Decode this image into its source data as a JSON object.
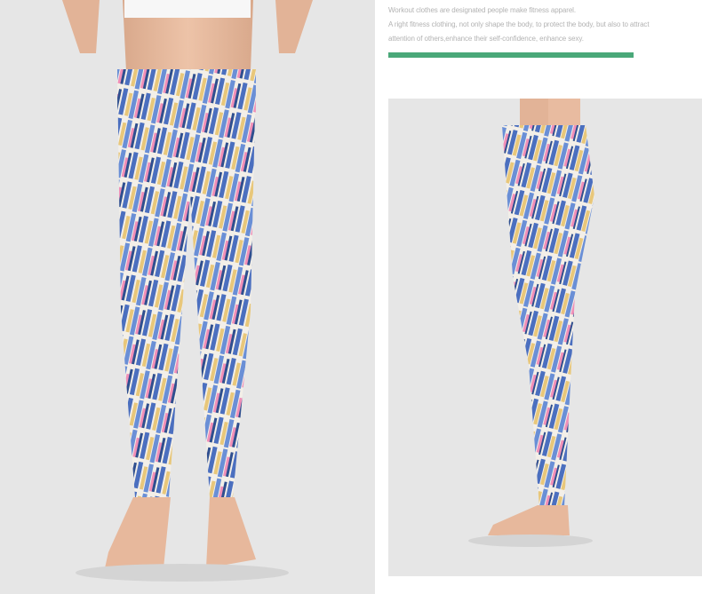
{
  "description": {
    "line1": "Workout clothes are designated people make fitness apparel.",
    "line2": "A right fitness clothing, not only shape the body, to protect the body, but also to attract",
    "line3": " attention of others,enhance their self-confidence, enhance sexy."
  },
  "colors": {
    "accent_bar": "#4aa879",
    "background": "#ffffff",
    "photo_background": "#e6e6e6",
    "text": "#b3b3b3"
  },
  "images": {
    "front": "front-view-leggings-photo",
    "side": "side-view-leggings-photo"
  }
}
